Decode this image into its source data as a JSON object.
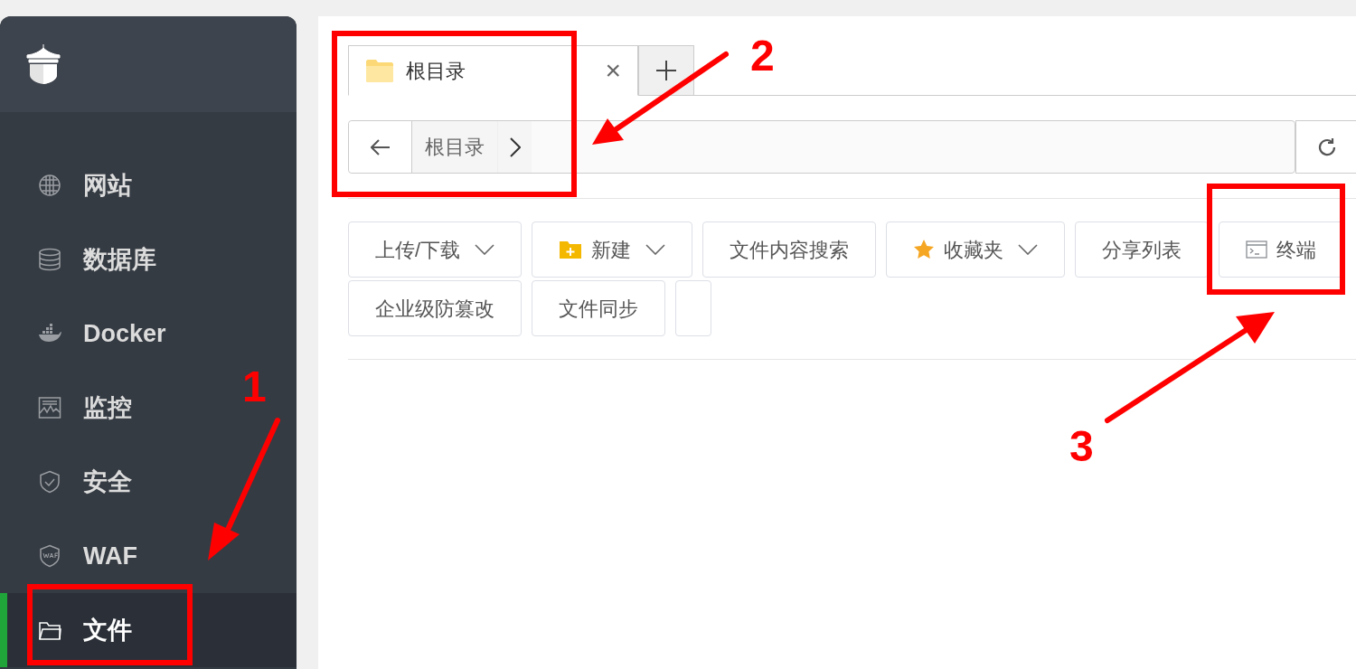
{
  "sidebar": {
    "items": [
      {
        "kind": "globe",
        "label": "网站",
        "selected": false
      },
      {
        "kind": "database",
        "label": "数据库",
        "selected": false
      },
      {
        "kind": "docker",
        "label": "Docker",
        "selected": false
      },
      {
        "kind": "monitor",
        "label": "监控",
        "selected": false
      },
      {
        "kind": "shield",
        "label": "安全",
        "selected": false
      },
      {
        "kind": "waf",
        "label": "WAF",
        "selected": false
      },
      {
        "kind": "folder",
        "label": "文件",
        "selected": true
      }
    ]
  },
  "tabs": [
    {
      "label": "根目录",
      "selected": true,
      "close": "×"
    }
  ],
  "breadcrumb": {
    "items": [
      "根目录"
    ]
  },
  "toolbar": {
    "buttons": [
      {
        "label": "上传/下载",
        "kind": "plain",
        "dropdown": true
      },
      {
        "label": "新建",
        "kind": "new-folder",
        "dropdown": true
      },
      {
        "label": "文件内容搜索",
        "kind": "plain",
        "dropdown": false
      },
      {
        "label": "收藏夹",
        "kind": "star",
        "dropdown": true
      },
      {
        "label": "分享列表",
        "kind": "plain",
        "dropdown": false
      },
      {
        "label": "终端",
        "kind": "terminal",
        "dropdown": false
      },
      {
        "label": "企业级防篡改",
        "kind": "plain",
        "dropdown": false
      },
      {
        "label": "文件同步",
        "kind": "plain",
        "dropdown": false
      }
    ]
  },
  "annotations": [
    {
      "number": "1"
    },
    {
      "number": "2"
    },
    {
      "number": "3"
    }
  ]
}
